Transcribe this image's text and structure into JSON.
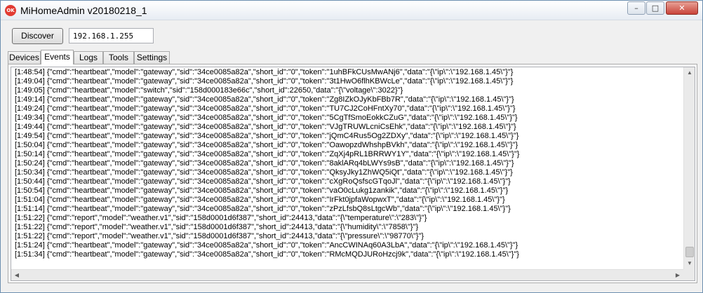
{
  "window": {
    "title": "MiHomeAdmin v20180218_1",
    "icon_label": "OK",
    "controls": {
      "minimize": "–",
      "maximize": "□",
      "close": "✕"
    }
  },
  "toolbar": {
    "discover_label": "Discover",
    "ip_value": "192.168.1.255"
  },
  "tabs": [
    {
      "label": "Devices",
      "active": false
    },
    {
      "label": "Events",
      "active": true
    },
    {
      "label": "Logs",
      "active": false
    },
    {
      "label": "Tools",
      "active": false
    },
    {
      "label": "Settings",
      "active": false
    }
  ],
  "scrollbar_arrows": {
    "up": "▲",
    "down": "▼",
    "left": "◀",
    "right": "▶"
  },
  "events": [
    "[1:48:54] {\"cmd\":\"heartbeat\",\"model\":\"gateway\",\"sid\":\"34ce0085a82a\",\"short_id\":\"0\",\"token\":\"1uhBFkCUsMwANj6\",\"data\":\"{\\\"ip\\\":\\\"192.168.1.45\\\"}\"}",
    "[1:49:04] {\"cmd\":\"heartbeat\",\"model\":\"gateway\",\"sid\":\"34ce0085a82a\",\"short_id\":\"0\",\"token\":\"3t1HwO6flhKBWcLe\",\"data\":\"{\\\"ip\\\":\\\"192.168.1.45\\\"}\"}",
    "[1:49:05] {\"cmd\":\"heartbeat\",\"model\":\"switch\",\"sid\":\"158d000183e66c\",\"short_id\":22650,\"data\":\"{\\\"voltage\\\":3022}\"}",
    "[1:49:14] {\"cmd\":\"heartbeat\",\"model\":\"gateway\",\"sid\":\"34ce0085a82a\",\"short_id\":\"0\",\"token\":\"Zg8IZkOJyKbFBb7R\",\"data\":\"{\\\"ip\\\":\\\"192.168.1.45\\\"}\"}",
    "[1:49:24] {\"cmd\":\"heartbeat\",\"model\":\"gateway\",\"sid\":\"34ce0085a82a\",\"short_id\":\"0\",\"token\":\"TU7CJ2CoHFntXy70\",\"data\":\"{\\\"ip\\\":\\\"192.168.1.45\\\"}\"}",
    "[1:49:34] {\"cmd\":\"heartbeat\",\"model\":\"gateway\",\"sid\":\"34ce0085a82a\",\"short_id\":\"0\",\"token\":\"5CgTfSmoEokkCZuG\",\"data\":\"{\\\"ip\\\":\\\"192.168.1.45\\\"}\"}",
    "[1:49:44] {\"cmd\":\"heartbeat\",\"model\":\"gateway\",\"sid\":\"34ce0085a82a\",\"short_id\":\"0\",\"token\":\"VJgTRUWLcniCsEhk\",\"data\":\"{\\\"ip\\\":\\\"192.168.1.45\\\"}\"}",
    "[1:49:54] {\"cmd\":\"heartbeat\",\"model\":\"gateway\",\"sid\":\"34ce0085a82a\",\"short_id\":\"0\",\"token\":\"jQmC4Rus5Og2ZDXy\",\"data\":\"{\\\"ip\\\":\\\"192.168.1.45\\\"}\"}",
    "[1:50:04] {\"cmd\":\"heartbeat\",\"model\":\"gateway\",\"sid\":\"34ce0085a82a\",\"short_id\":\"0\",\"token\":\"OawopzdWhshpBVkh\",\"data\":\"{\\\"ip\\\":\\\"192.168.1.45\\\"}\"}",
    "[1:50:14] {\"cmd\":\"heartbeat\",\"model\":\"gateway\",\"sid\":\"34ce0085a82a\",\"short_id\":\"0\",\"token\":\"ZqXj4pRL1BRRWY1Y\",\"data\":\"{\\\"ip\\\":\\\"192.168.1.45\\\"}\"}",
    "[1:50:24] {\"cmd\":\"heartbeat\",\"model\":\"gateway\",\"sid\":\"34ce0085a82a\",\"short_id\":\"0\",\"token\":\"8aklARq4bLWYs9sB\",\"data\":\"{\\\"ip\\\":\\\"192.168.1.45\\\"}\"}",
    "[1:50:34] {\"cmd\":\"heartbeat\",\"model\":\"gateway\",\"sid\":\"34ce0085a82a\",\"short_id\":\"0\",\"token\":\"QksyJky1ZhWQ5iQt\",\"data\":\"{\\\"ip\\\":\\\"192.168.1.45\\\"}\"}",
    "[1:50:44] {\"cmd\":\"heartbeat\",\"model\":\"gateway\",\"sid\":\"34ce0085a82a\",\"short_id\":\"0\",\"token\":\"cXgRoQsfscGTqoJl\",\"data\":\"{\\\"ip\\\":\\\"192.168.1.45\\\"}\"}",
    "[1:50:54] {\"cmd\":\"heartbeat\",\"model\":\"gateway\",\"sid\":\"34ce0085a82a\",\"short_id\":\"0\",\"token\":\"vaO0cLukg1zankik\",\"data\":\"{\\\"ip\\\":\\\"192.168.1.45\\\"}\"}",
    "[1:51:04] {\"cmd\":\"heartbeat\",\"model\":\"gateway\",\"sid\":\"34ce0085a82a\",\"short_id\":\"0\",\"token\":\"IrFkt0jpfaWopwxT\",\"data\":\"{\\\"ip\\\":\\\"192.168.1.45\\\"}\"}",
    "[1:51:14] {\"cmd\":\"heartbeat\",\"model\":\"gateway\",\"sid\":\"34ce0085a82a\",\"short_id\":\"0\",\"token\":\"zPzLfsbQ8sLtgcWb\",\"data\":\"{\\\"ip\\\":\\\"192.168.1.45\\\"}\"}",
    "[1:51:22] {\"cmd\":\"report\",\"model\":\"weather.v1\",\"sid\":\"158d0001d6f387\",\"short_id\":24413,\"data\":\"{\\\"temperature\\\":\\\"283\\\"}\"}",
    "[1:51:22] {\"cmd\":\"report\",\"model\":\"weather.v1\",\"sid\":\"158d0001d6f387\",\"short_id\":24413,\"data\":\"{\\\"humidity\\\":\\\"7858\\\"}\"}",
    "[1:51:22] {\"cmd\":\"report\",\"model\":\"weather.v1\",\"sid\":\"158d0001d6f387\",\"short_id\":24413,\"data\":\"{\\\"pressure\\\":\\\"98770\\\"}\"}",
    "[1:51:24] {\"cmd\":\"heartbeat\",\"model\":\"gateway\",\"sid\":\"34ce0085a82a\",\"short_id\":\"0\",\"token\":\"AncCWINAq60A3LbA\",\"data\":\"{\\\"ip\\\":\\\"192.168.1.45\\\"}\"}",
    "[1:51:34] {\"cmd\":\"heartbeat\",\"model\":\"gateway\",\"sid\":\"34ce0085a82a\",\"short_id\":\"0\",\"token\":\"RMcMQDJURoHzcj9k\",\"data\":\"{\\\"ip\\\":\\\"192.168.1.45\\\"}\"}"
  ]
}
